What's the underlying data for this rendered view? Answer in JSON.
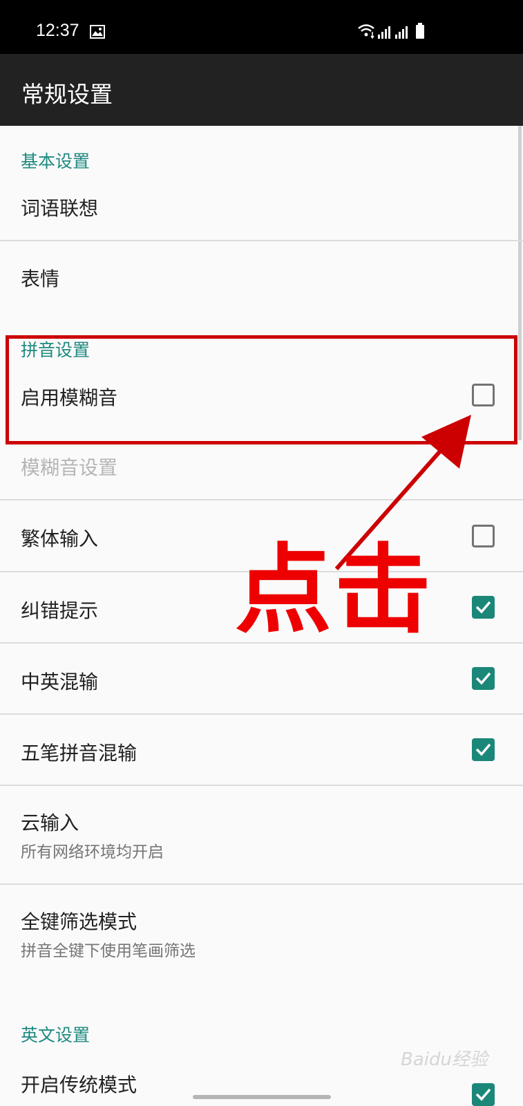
{
  "status_bar": {
    "time": "12:37"
  },
  "app_bar": {
    "title": "常规设置"
  },
  "sections": {
    "basic": {
      "header": "基本设置",
      "items": [
        {
          "title": "词语联想"
        },
        {
          "title": "表情"
        }
      ]
    },
    "pinyin": {
      "header": "拼音设置",
      "items": [
        {
          "title": "启用模糊音",
          "checked": false
        },
        {
          "title": "模糊音设置",
          "disabled": true
        },
        {
          "title": "繁体输入",
          "checked": false
        },
        {
          "title": "纠错提示",
          "checked": true
        },
        {
          "title": "中英混输",
          "checked": true
        },
        {
          "title": "五笔拼音混输",
          "checked": true
        },
        {
          "title": "云输入",
          "subtitle": "所有网络环境均开启"
        },
        {
          "title": "全键筛选模式",
          "subtitle": "拼音全键下使用笔画筛选"
        }
      ]
    },
    "english": {
      "header": "英文设置",
      "items": [
        {
          "title": "开启传统模式",
          "checked": true
        }
      ]
    }
  },
  "annotation": {
    "label": "点击",
    "color": "#e00000"
  },
  "watermark": {
    "text": "Baidu经验"
  },
  "colors": {
    "accent": "#1a8779",
    "header_text": "#1e8a80",
    "app_bar": "#222222"
  }
}
